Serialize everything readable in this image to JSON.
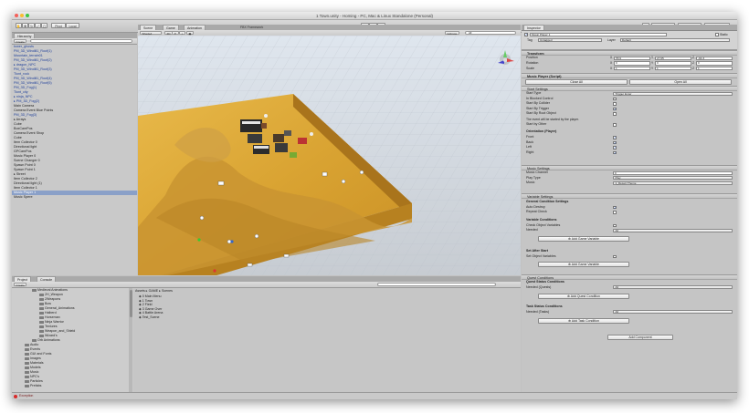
{
  "window": {
    "title": "1 Town.unity - Homing - PC, Mac & Linux Standalone (Personal)"
  },
  "toolbar": {
    "pivot": "Pivot",
    "local": "Local",
    "account": "Account",
    "layers": "Layers",
    "layout": "Layout"
  },
  "hierarchy": {
    "tab": "Hierarchy",
    "create": "Create",
    "items": [
      {
        "label": "tower_ghosts",
        "style": "blue"
      },
      {
        "label": "PM_3D_Windill1_Roof(1)",
        "style": "blue"
      },
      {
        "label": "Mountain_terrain01",
        "style": "blue"
      },
      {
        "label": "PM_3D_Windill1_Roof(2)",
        "style": "blue"
      },
      {
        "label": "▸ dragon_NPC",
        "style": "blue"
      },
      {
        "label": "PM_3D_Windill1_Roof(3)",
        "style": "blue"
      },
      {
        "label": "Tiont_rock",
        "style": "blue"
      },
      {
        "label": "PM_3D_Windill1_Roof(4)",
        "style": "blue"
      },
      {
        "label": "PM_3D_Windill1_Roof(5)",
        "style": "blue"
      },
      {
        "label": "PM_3D_Fog(1)",
        "style": "blue"
      },
      {
        "label": "Tiont_city",
        "style": "blue"
      },
      {
        "label": "▸ ninja_NPC",
        "style": "blue"
      },
      {
        "label": "▸ PM_3D_Fog(2)",
        "style": "blue"
      },
      {
        "label": "Main Camera",
        "style": ""
      },
      {
        "label": "Camera Event Blue Points",
        "style": ""
      },
      {
        "label": "PM_3D_Fog(3)",
        "style": "blue"
      },
      {
        "label": "▸ Arrays",
        "style": ""
      },
      {
        "label": "Cube",
        "style": ""
      },
      {
        "label": "BoxCamPos",
        "style": ""
      },
      {
        "label": "Camera Event Shop",
        "style": ""
      },
      {
        "label": "Cube",
        "style": ""
      },
      {
        "label": "Item Collector 0",
        "style": ""
      },
      {
        "label": "Directional light",
        "style": ""
      },
      {
        "label": "GPCamPos",
        "style": ""
      },
      {
        "label": "Music Player 0",
        "style": ""
      },
      {
        "label": "Scene Changer 0",
        "style": ""
      },
      {
        "label": "Spawn Point 0",
        "style": ""
      },
      {
        "label": "Spawn Point 1",
        "style": ""
      },
      {
        "label": "▸ Street",
        "style": ""
      },
      {
        "label": "Item Collector 2",
        "style": ""
      },
      {
        "label": "Directional light (1)",
        "style": ""
      },
      {
        "label": "Item Collector 1",
        "style": ""
      },
      {
        "label": "Music Player 1",
        "style": "sel"
      },
      {
        "label": "Music Spere",
        "style": ""
      }
    ]
  },
  "scene": {
    "tabs": [
      "Scene",
      "Game",
      "Animation"
    ],
    "fps": "FBX Framework",
    "shading": "Shaded",
    "mode_2d": "2D",
    "gizmos": "Gizmos",
    "search": "All"
  },
  "project": {
    "tabs": [
      "Project",
      "Console"
    ],
    "create": "Create",
    "tree": [
      {
        "label": "Medieval Animations",
        "indent": 4
      },
      {
        "label": "2H_Weapon",
        "indent": 6
      },
      {
        "label": "2Weapons",
        "indent": 6
      },
      {
        "label": "Bow",
        "indent": 6
      },
      {
        "label": "General_Animations",
        "indent": 6
      },
      {
        "label": "Halberd",
        "indent": 6
      },
      {
        "label": "Horseman",
        "indent": 6
      },
      {
        "label": "Ninja Warrior",
        "indent": 6
      },
      {
        "label": "Textures",
        "indent": 6
      },
      {
        "label": "Weapon_and_Shield",
        "indent": 6
      },
      {
        "label": "Wizard's",
        "indent": 6
      },
      {
        "label": "Orb Animations",
        "indent": 4
      },
      {
        "label": "Audio",
        "indent": 2
      },
      {
        "label": "Events",
        "indent": 2
      },
      {
        "label": "GUI and Fonts",
        "indent": 2
      },
      {
        "label": "Images",
        "indent": 2
      },
      {
        "label": "Materials",
        "indent": 2
      },
      {
        "label": "Models",
        "indent": 2
      },
      {
        "label": "Music",
        "indent": 2
      },
      {
        "label": "NPC's",
        "indent": 2
      },
      {
        "label": "Particles",
        "indent": 2
      },
      {
        "label": "Prefabs",
        "indent": 2
      }
    ],
    "breadcrumb": "Assets ▸ GAME ▸ Scenes",
    "files": [
      "0 Main Menu",
      "1 Town",
      "2 Field",
      "3 Game Over",
      "4 Battle Arena",
      "Test_Scene"
    ]
  },
  "inspector": {
    "tab": "Inspector",
    "object_name": "Music Player 1",
    "static": "Static",
    "tag_label": "Tag",
    "tag_value": "Untagged",
    "layer_label": "Layer",
    "layer_value": "Default",
    "transform": {
      "title": "Transform",
      "rows": [
        {
          "label": "Position",
          "x": "55.9",
          "y": "27.65",
          "z": "-94.3"
        },
        {
          "label": "Rotation",
          "x": "0",
          "y": "0",
          "z": "0"
        },
        {
          "label": "Scale",
          "x": "1",
          "y": "1",
          "z": "1"
        }
      ]
    },
    "script": {
      "title": "Music Player (Script)",
      "close_all": "Close All",
      "open_all": "Open All"
    },
    "start_settings": {
      "title": "Start Settings",
      "start_type_label": "Start Type",
      "start_type_value": "Trigger Enter",
      "rows": [
        {
          "label": "In Blocked Control",
          "checked": false
        },
        {
          "label": "Start By Collider",
          "checked": false
        },
        {
          "label": "Start By Trigger",
          "checked": true
        },
        {
          "label": "Start By Root Object",
          "checked": false
        }
      ],
      "note": "The event will be started by the player.",
      "start_by_other": "Start by Other"
    },
    "orientation": {
      "title": "Orientation (Player)",
      "rows": [
        {
          "label": "Front",
          "checked": true
        },
        {
          "label": "Back",
          "checked": true
        },
        {
          "label": "Left",
          "checked": true
        },
        {
          "label": "Right",
          "checked": true
        }
      ]
    },
    "music_settings": {
      "title": "Music Settings",
      "channel_label": "Music Channel",
      "channel_value": "0",
      "play_type_label": "Play Type",
      "play_type_value": "Play",
      "music_label": "Music",
      "music_value": "1_Desert Theme"
    },
    "variable_settings": {
      "title": "Variable Settings",
      "general_title": "General Condition Settings",
      "auto_destroy": "Auto Destroy",
      "repeat_check": "Repeat Check",
      "var_conditions": "Variable Conditions",
      "check_object_vars": "Check Object Variables",
      "needed": "Needed",
      "needed_value": "All",
      "add_var_btn": "Add Game Variable",
      "set_after_start": "Set After Start",
      "set_object_vars": "Set Object Variables",
      "add_var_btn2": "Add Game Variable"
    },
    "quest_conditions": {
      "title": "Quest Conditions",
      "quest_status": "Quest Status Conditions",
      "needed_quests": "Needed (Quests)",
      "needed_quests_value": "All",
      "add_quest_btn": "Add Quest Condition",
      "task_status": "Task Status Conditions",
      "needed_tasks": "Needed (Tasks)",
      "needed_tasks_value": "All",
      "add_task_btn": "Add Task Condition"
    },
    "add_component": "Add Component"
  },
  "status": {
    "error_text": "Exception"
  }
}
